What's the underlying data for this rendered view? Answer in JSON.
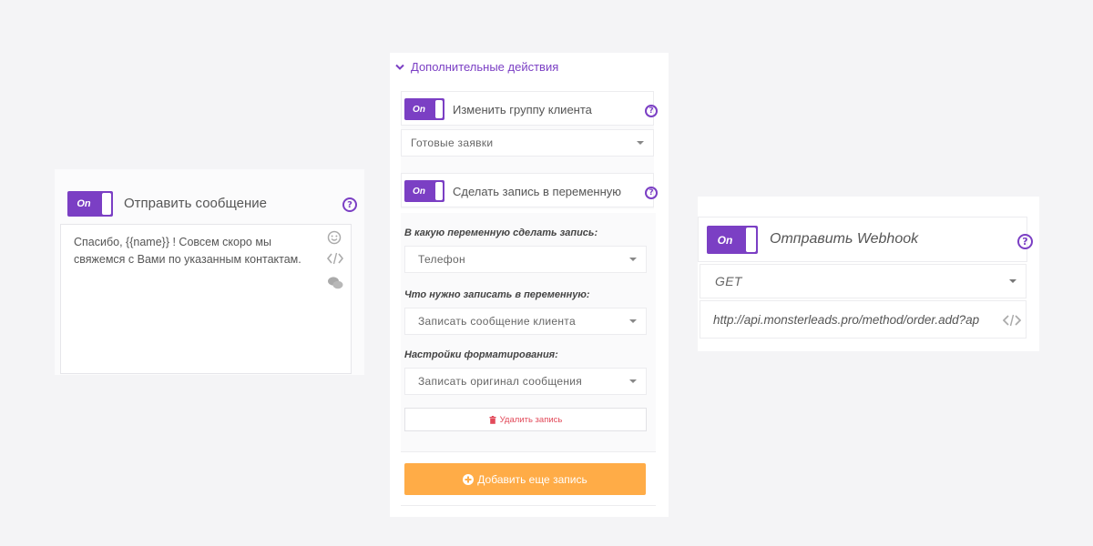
{
  "send_message": {
    "toggle_label": "On",
    "title": "Отправить сообщение",
    "help_icon": "?",
    "message_line1": "Спасибо, {{name}} ! Совсем скоро мы",
    "message_line2": "свяжемся с Вами по указанным контактам.",
    "icons": [
      "smile-icon",
      "code-icon",
      "chat-icon"
    ]
  },
  "additional_actions": {
    "header": "Дополнительные действия",
    "change_group": {
      "toggle_label": "On",
      "title": "Изменить группу клиента",
      "help_icon": "?",
      "selected": "Готовые заявки"
    },
    "write_variable": {
      "toggle_label": "On",
      "title": "Сделать запись в переменную",
      "help_icon": "?"
    },
    "variable_label": "В какую переменную сделать запись:",
    "variable_selected": "Телефон",
    "what_label": "Что нужно записать в переменную:",
    "what_selected": "Записать сообщение клиента",
    "format_label": "Настройки форматирования:",
    "format_selected": "Записать оригинал сообщения",
    "delete_button": "Удалить запись",
    "add_button": "Добавить еще запись"
  },
  "webhook": {
    "toggle_label": "On",
    "title": "Отправить Webhook",
    "help_icon": "?",
    "method": "GET",
    "url": "http://api.monsterleads.pro/method/order.add?ap"
  },
  "colors": {
    "accent": "#7b3fc4",
    "add_button": "#ffac47",
    "delete": "#e24a5a"
  }
}
